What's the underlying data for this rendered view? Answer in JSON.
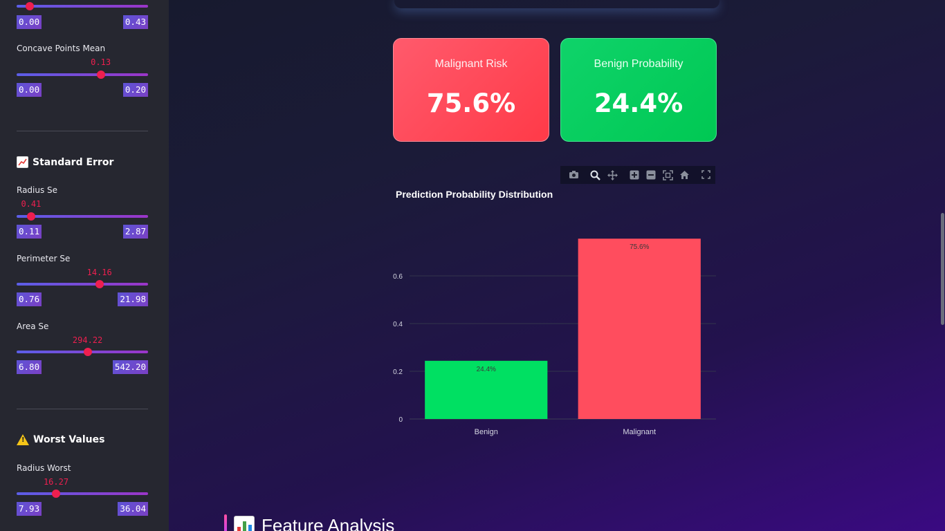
{
  "sidebar": {
    "sliders": [
      {
        "label": "",
        "current": "",
        "min": "0.00",
        "max": "0.43",
        "fraction": 0.1
      },
      {
        "label": "Concave Points Mean",
        "current": "0.13",
        "min": "0.00",
        "max": "0.20",
        "fraction": 0.64
      },
      {
        "label": "Radius Se",
        "current": "0.41",
        "min": "0.11",
        "max": "2.87",
        "fraction": 0.11
      },
      {
        "label": "Perimeter Se",
        "current": "14.16",
        "min": "0.76",
        "max": "21.98",
        "fraction": 0.63
      },
      {
        "label": "Area Se",
        "current": "294.22",
        "min": "6.80",
        "max": "542.20",
        "fraction": 0.54
      },
      {
        "label": "Radius Worst",
        "current": "16.27",
        "min": "7.93",
        "max": "36.04",
        "fraction": 0.3
      }
    ],
    "sections": {
      "standard_error": "Standard Error",
      "worst_values": "Worst Values"
    }
  },
  "metrics": {
    "malignant": {
      "title": "Malignant Risk",
      "value": "75.6%",
      "color": "#ff4b5c"
    },
    "benign": {
      "title": "Benign Probability",
      "value": "24.4%",
      "color": "#00d25b"
    }
  },
  "modebar": {
    "icons": [
      "camera-icon",
      "zoom-icon",
      "pan-icon",
      "zoom-in-icon",
      "zoom-out-icon",
      "autoscale-icon",
      "reset-axes-icon",
      "fullscreen-icon"
    ]
  },
  "chart_data": {
    "type": "bar",
    "title": "Prediction Probability Distribution",
    "categories": [
      "Benign",
      "Malignant"
    ],
    "values": [
      0.244,
      0.756
    ],
    "labels": [
      "24.4%",
      "75.6%"
    ],
    "colors": [
      "#00e062",
      "#ff4d5e"
    ],
    "yticks": [
      "0",
      "0.2",
      "0.4",
      "0.6"
    ],
    "ylim": [
      0,
      0.8
    ],
    "xlabel": "",
    "ylabel": "",
    "grid": true
  },
  "feature_section": {
    "title": "Feature Analysis"
  }
}
